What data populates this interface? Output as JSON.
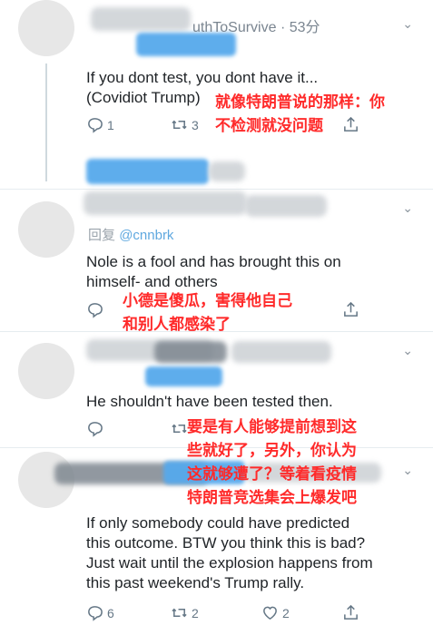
{
  "tweets": [
    {
      "meta": "uthToSurvive · 53分",
      "text_lines": [
        "If you dont test, you dont have it...",
        "(Covidiot Trump)"
      ],
      "actions": {
        "replies": "1",
        "retweets": "3"
      },
      "annotation": [
        "就像特朗普说的那样：你",
        "不检测就没问题"
      ]
    },
    {
      "reply_label": "回复",
      "reply_handle": "@cnnbrk",
      "text_lines": [
        "Nole is a fool and has brought this on",
        "himself- and others"
      ],
      "annotation": [
        "小德是傻瓜，害得他自己",
        "和别人都感染了"
      ]
    },
    {
      "text_lines": [
        "He shouldn't have been tested then."
      ],
      "annotation": [
        "要是有人能够提前想到这",
        "些就好了，另外，你认为",
        "这就够遭了？等着看疫情",
        "特朗普竞选集会上爆发吧"
      ]
    },
    {
      "text_lines": [
        "If only somebody could have predicted",
        "this outcome. BTW you think this is bad?",
        "Just wait until the explosion happens from",
        "this past weekend's Trump rally."
      ],
      "actions": {
        "replies": "6",
        "retweets": "2",
        "likes": "2"
      }
    }
  ],
  "colors": {
    "annotation": "#ff2a2a",
    "mention": "#5fa8df",
    "redaction_blue": "#56a9ec"
  }
}
